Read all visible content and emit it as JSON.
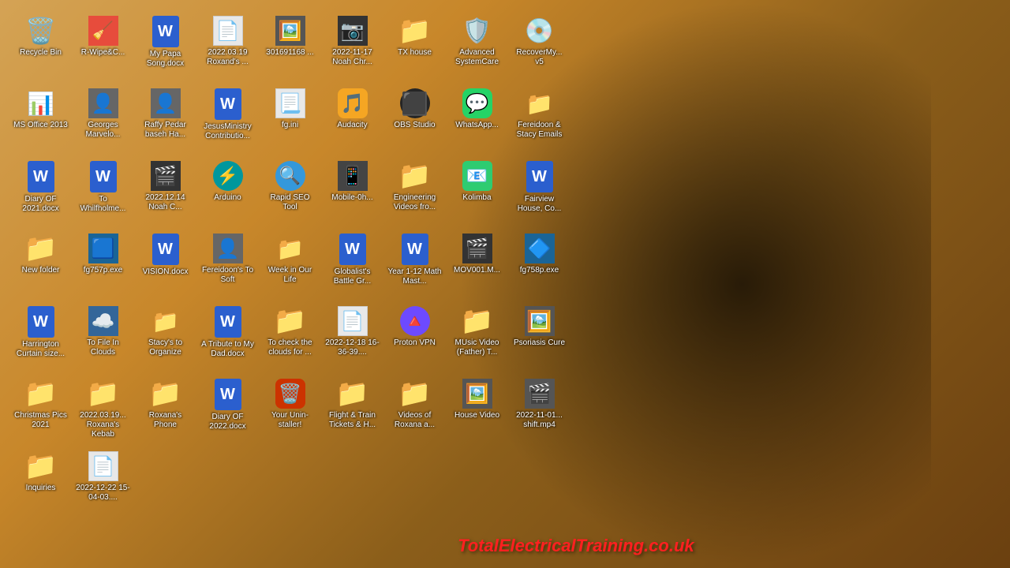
{
  "desktop": {
    "wallpaper_desc": "Cowboy silhouette on golden background",
    "watermark": "TotalElectricalTraining.co.uk",
    "icons": [
      {
        "id": "recycle-bin",
        "label": "Recycle Bin",
        "type": "system",
        "symbol": "🗑️",
        "col": 1,
        "row": 1
      },
      {
        "id": "r-wipe",
        "label": "R-Wipe&C...",
        "type": "app",
        "symbol": "🧹",
        "col": 2,
        "row": 1
      },
      {
        "id": "my-papa",
        "label": "My Papa Song.docx",
        "type": "word",
        "col": 3,
        "row": 1
      },
      {
        "id": "2022-03-19-roxana",
        "label": "2022.03.19 Roxand's ...",
        "type": "file",
        "symbol": "📄",
        "col": 4,
        "row": 1
      },
      {
        "id": "301691168",
        "label": "301691168 ...",
        "type": "image",
        "symbol": "🖼️",
        "col": 5,
        "row": 1
      },
      {
        "id": "2022-11-17-noah",
        "label": "2022-11-17 Noah Chr...",
        "type": "image",
        "symbol": "📷",
        "col": 6,
        "row": 1
      },
      {
        "id": "tx-house",
        "label": "TX house",
        "type": "folder",
        "col": 7,
        "row": 1
      },
      {
        "id": "advanced-systemcare",
        "label": "Advanced SystemCare",
        "type": "app",
        "symbol": "🛡️",
        "col": 1,
        "row": 2
      },
      {
        "id": "recovermy",
        "label": "RecoverMy... v5",
        "type": "app",
        "symbol": "💾",
        "col": 2,
        "row": 2
      },
      {
        "id": "ms-office-2013",
        "label": "MS Office 2013",
        "type": "app",
        "symbol": "📊",
        "col": 3,
        "row": 2
      },
      {
        "id": "georges-marvelo",
        "label": "Georges Marvelo...",
        "type": "image",
        "symbol": "👤",
        "col": 4,
        "row": 2
      },
      {
        "id": "raffy-pedar",
        "label": "Raffy Pedar baseh Ha...",
        "type": "image",
        "symbol": "👤",
        "col": 5,
        "row": 2
      },
      {
        "id": "jesus-ministry",
        "label": "JesusMinistry Contributio...",
        "type": "word",
        "col": 6,
        "row": 2
      },
      {
        "id": "fg-ini",
        "label": "fg.ini",
        "type": "file",
        "symbol": "📃",
        "col": 7,
        "row": 2
      },
      {
        "id": "audacity",
        "label": "Audacity",
        "type": "app",
        "symbol": "🎵",
        "col": 1,
        "row": 3
      },
      {
        "id": "obs-studio",
        "label": "OBS Studio",
        "type": "app",
        "symbol": "📹",
        "col": 2,
        "row": 3
      },
      {
        "id": "whatsapp",
        "label": "WhatsApp...",
        "type": "app",
        "symbol": "💬",
        "col": 3,
        "row": 3
      },
      {
        "id": "fereidoon-stacy",
        "label": "Fereidoon & Stacy Emails",
        "type": "folder",
        "col": 4,
        "row": 3
      },
      {
        "id": "diary-of-2021",
        "label": "Diary OF 2021.docx",
        "type": "word",
        "col": 5,
        "row": 3
      },
      {
        "id": "to-whilfholme",
        "label": "To Whilfholme...",
        "type": "word",
        "col": 6,
        "row": 3
      },
      {
        "id": "2022-12-14-noah",
        "label": "2022.12.14 Noah C...",
        "type": "image",
        "symbol": "📷",
        "col": 7,
        "row": 3
      },
      {
        "id": "arduino",
        "label": "Arduino",
        "type": "app",
        "symbol": "⚡",
        "col": 1,
        "row": 4
      },
      {
        "id": "rapid-seo",
        "label": "Rapid SEO Tool",
        "type": "app",
        "symbol": "🔍",
        "col": 2,
        "row": 4
      },
      {
        "id": "mobile-0h",
        "label": "Mobile-0h...",
        "type": "image",
        "symbol": "📱",
        "col": 3,
        "row": 4
      },
      {
        "id": "engineering-videos",
        "label": "Engineering Videos fro...",
        "type": "folder",
        "col": 4,
        "row": 4
      },
      {
        "id": "kolimba",
        "label": "Kolimba",
        "type": "app",
        "symbol": "📧",
        "col": 5,
        "row": 4
      },
      {
        "id": "fairview-house",
        "label": "Fairview House, Co...",
        "type": "word",
        "col": 6,
        "row": 4
      },
      {
        "id": "new-folder",
        "label": "New folder",
        "type": "folder",
        "col": 7,
        "row": 4
      },
      {
        "id": "fg757p-exe",
        "label": "fg757p.exe",
        "type": "app",
        "symbol": "🔧",
        "col": 1,
        "row": 5
      },
      {
        "id": "vision-docx",
        "label": "VISION.docx",
        "type": "word",
        "col": 2,
        "row": 5
      },
      {
        "id": "fereidoons-to-soft",
        "label": "Fereidoon's To Soft",
        "type": "image",
        "symbol": "👤",
        "col": 3,
        "row": 5
      },
      {
        "id": "week-in-our-life",
        "label": "Week in Our Life",
        "type": "folder",
        "col": 4,
        "row": 5
      },
      {
        "id": "globalists-battle",
        "label": "Globalist's Battle Gr...",
        "type": "word",
        "col": 5,
        "row": 5
      },
      {
        "id": "year-1-12-math",
        "label": "Year 1-12 Math Mast...",
        "type": "word",
        "col": 6,
        "row": 5
      },
      {
        "id": "mov001-m",
        "label": "MOV001.M...",
        "type": "image",
        "symbol": "🎬",
        "col": 7,
        "row": 5
      },
      {
        "id": "fg758p-exe",
        "label": "fg758p.exe",
        "type": "app",
        "symbol": "🔧",
        "col": 1,
        "row": 6
      },
      {
        "id": "harrington-curtain",
        "label": "Harrington Curtain size...",
        "type": "word",
        "col": 2,
        "row": 6
      },
      {
        "id": "to-file-in-clouds",
        "label": "To File In Clouds",
        "type": "image",
        "symbol": "☁️",
        "col": 3,
        "row": 6
      },
      {
        "id": "stacys-to-organize",
        "label": "Stacy's to Organize",
        "type": "folder",
        "col": 4,
        "row": 6
      },
      {
        "id": "tribute-to-my-dad",
        "label": "A Tribute to My Dad.docx",
        "type": "word",
        "col": 5,
        "row": 6
      },
      {
        "id": "to-check-the-clouds",
        "label": "To check the clouds for ...",
        "type": "folder",
        "col": 6,
        "row": 6
      },
      {
        "id": "2022-12-18",
        "label": "2022-12-18 16-36-39....",
        "type": "file",
        "symbol": "📄",
        "col": 7,
        "row": 6
      },
      {
        "id": "proton-vpn",
        "label": "Proton VPN",
        "type": "app",
        "symbol": "🔒",
        "col": 1,
        "row": 7
      },
      {
        "id": "music-video-father",
        "label": "MUsic Video (Father) T...",
        "type": "folder",
        "col": 2,
        "row": 7
      },
      {
        "id": "psoriasis-cure",
        "label": "Psoriasis Cure",
        "type": "image",
        "symbol": "🏥",
        "col": 3,
        "row": 7
      },
      {
        "id": "christmas-pics-2021",
        "label": "Christmas Pics 2021",
        "type": "folder",
        "col": 4,
        "row": 7
      },
      {
        "id": "2022-03-19-kebab",
        "label": "2022.03.19... Roxana's Kebab",
        "type": "folder",
        "col": 5,
        "row": 7
      },
      {
        "id": "roxanas-phone",
        "label": "Roxana's Phone",
        "type": "folder",
        "col": 6,
        "row": 7
      },
      {
        "id": "diary-of-2022",
        "label": "Diary OF 2022.docx",
        "type": "word",
        "col": 7,
        "row": 7
      },
      {
        "id": "your-uninstaller",
        "label": "Your Unin-staller!",
        "type": "app",
        "symbol": "🗑️",
        "col": 1,
        "row": 8
      },
      {
        "id": "flight-train",
        "label": "Flight & Train Tickets & H...",
        "type": "folder",
        "col": 2,
        "row": 8
      },
      {
        "id": "videos-of-roxana",
        "label": "Videos of Roxana a...",
        "type": "folder",
        "col": 3,
        "row": 8
      },
      {
        "id": "house-video",
        "label": "House Video",
        "type": "image",
        "symbol": "🏠",
        "col": 4,
        "row": 8
      },
      {
        "id": "2022-11-01-shift",
        "label": "2022-11-01... shift.mp4",
        "type": "image",
        "symbol": "🎬",
        "col": 5,
        "row": 8
      },
      {
        "id": "inquiries",
        "label": "Inquiries",
        "type": "folder",
        "col": 6,
        "row": 8
      },
      {
        "id": "2022-12-22",
        "label": "2022-12-22 15-04-03....",
        "type": "file",
        "symbol": "📄",
        "col": 7,
        "row": 8
      }
    ]
  }
}
